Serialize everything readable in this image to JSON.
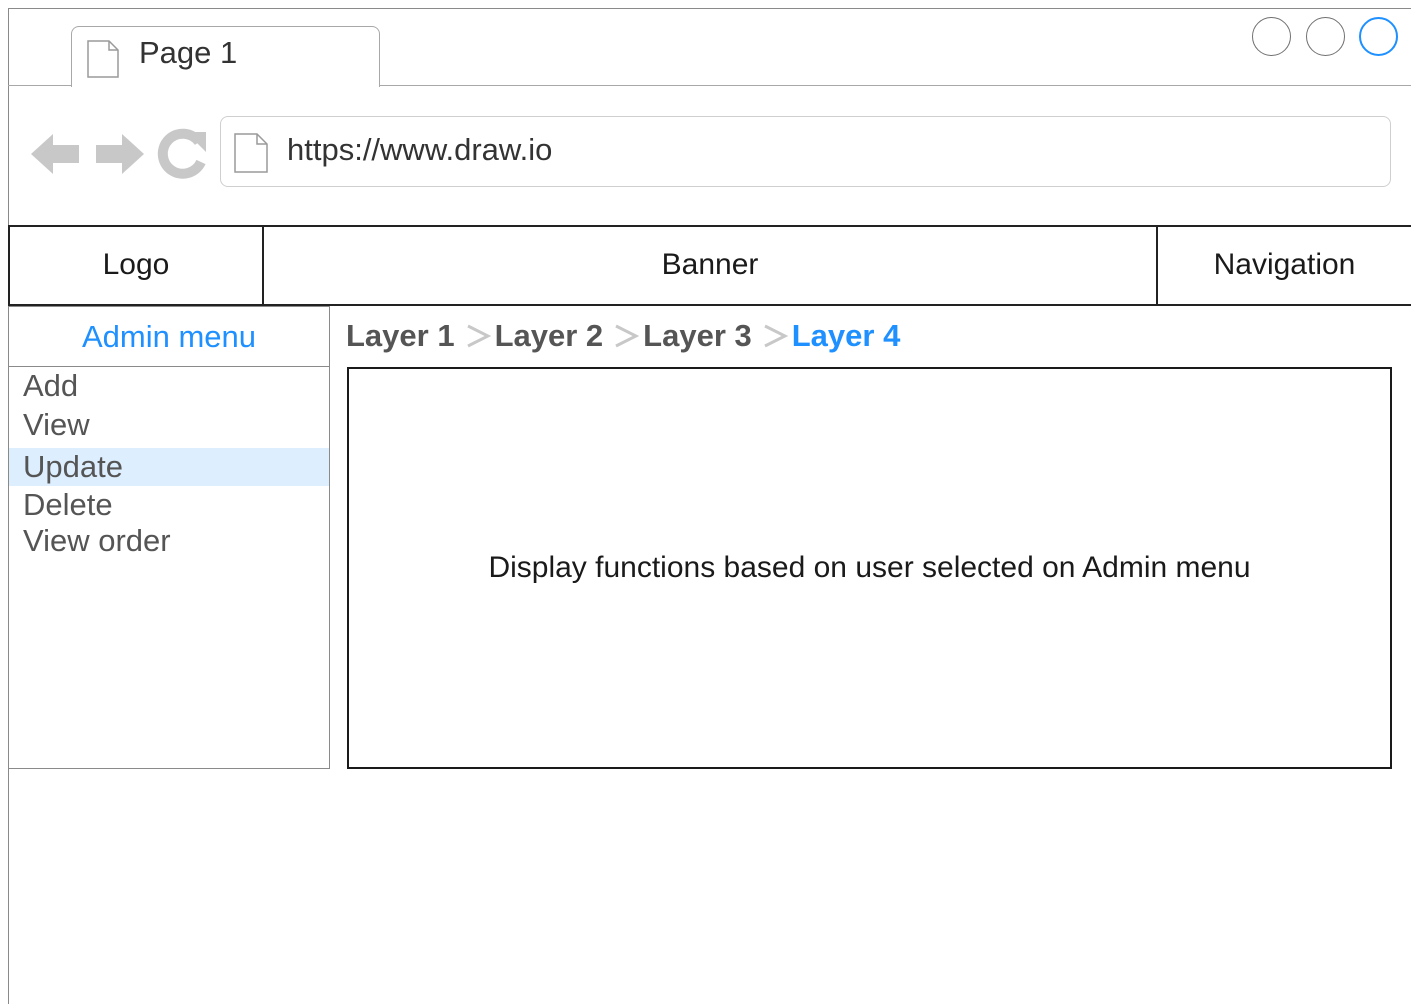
{
  "browser": {
    "tab": {
      "label": "Page 1"
    },
    "url": "https://www.draw.io",
    "window_buttons": [
      "minimize",
      "maximize",
      "close"
    ]
  },
  "header": {
    "logo": "Logo",
    "banner": "Banner",
    "navigation": "Navigation"
  },
  "admin_menu": {
    "title": "Admin menu",
    "items": [
      {
        "label": "Add"
      },
      {
        "label": "View"
      },
      {
        "label": "Update",
        "selected": true
      },
      {
        "label": "Delete"
      },
      {
        "label": "View order"
      }
    ]
  },
  "breadcrumb": {
    "items": [
      "Layer 1",
      "Layer 2",
      "Layer 3",
      "Layer 4"
    ],
    "active_index": 3
  },
  "content": {
    "text": "Display functions based on user selected on Admin menu"
  },
  "colors": {
    "accent": "#1e90ff",
    "selected_bg": "#ddeeff",
    "icon_gray": "#c8c8c8"
  }
}
